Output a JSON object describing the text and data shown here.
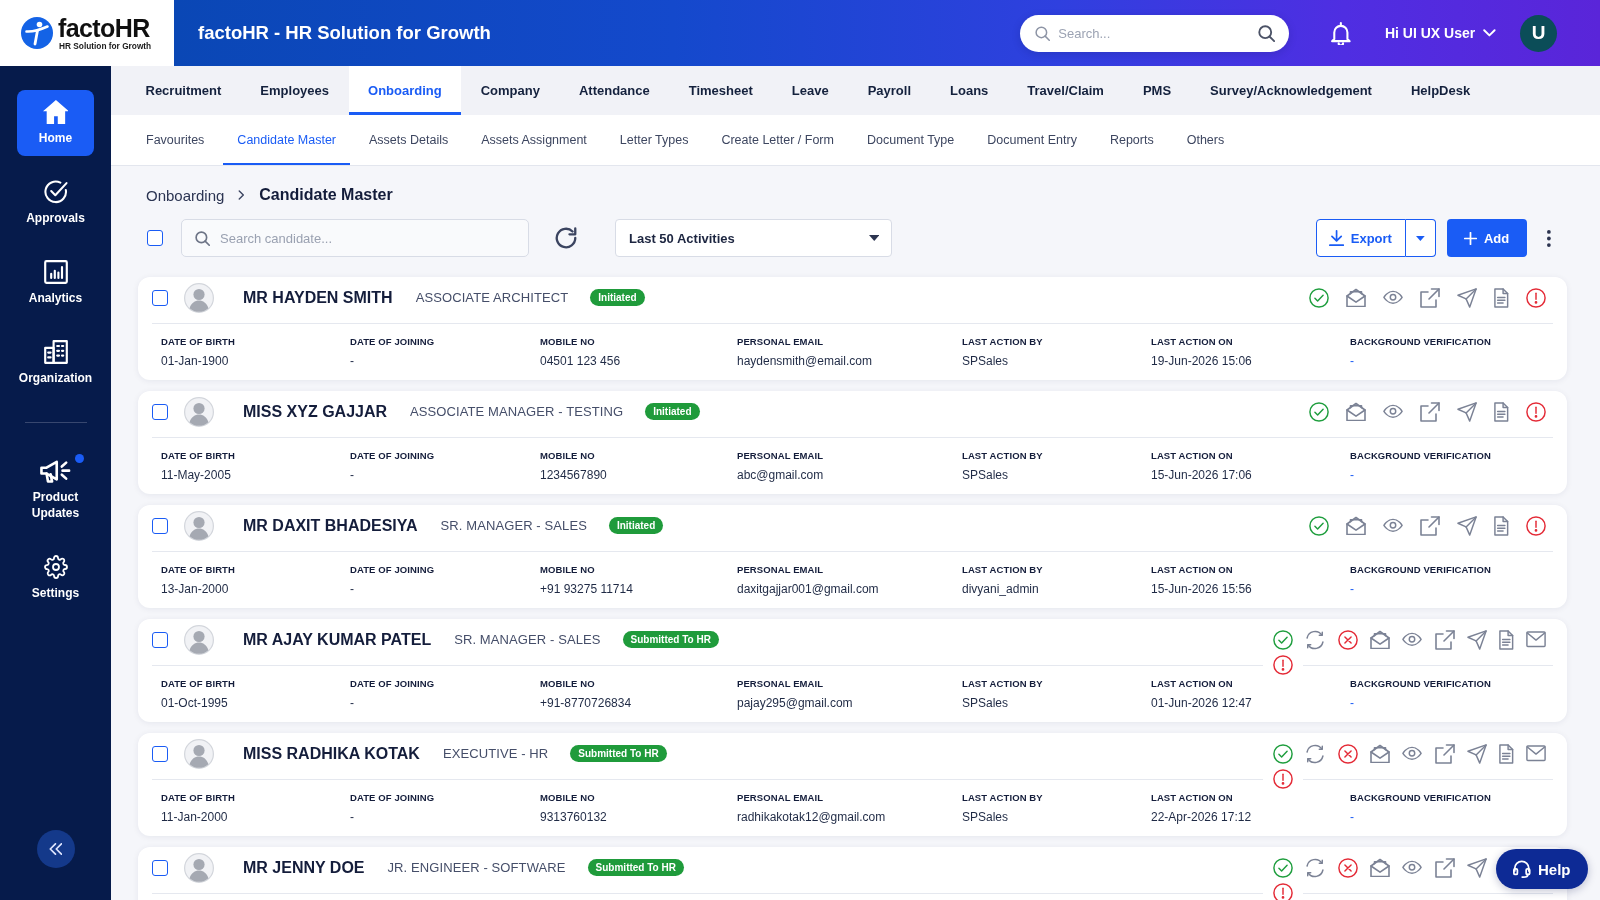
{
  "header": {
    "logo": {
      "name": "factoHR",
      "tagline": "HR Solution for Growth"
    },
    "title": "factoHR - HR Solution for Growth",
    "search": {
      "placeholder": "Search..."
    },
    "user": {
      "greeting": "Hi UI UX User",
      "initial": "U"
    }
  },
  "sidebar": {
    "sections": [
      {
        "items": [
          {
            "label": "Home",
            "selected": true,
            "unread": false
          },
          {
            "label": "Approvals",
            "selected": false,
            "unread": false
          },
          {
            "label": "Analytics",
            "selected": false,
            "unread": false
          },
          {
            "label": "Organization",
            "selected": false,
            "unread": false
          }
        ]
      },
      {
        "items": [
          {
            "label": "Product Updates",
            "selected": false,
            "unread": true
          },
          {
            "label": "Settings",
            "selected": false,
            "unread": false
          }
        ]
      }
    ]
  },
  "nav_tabs": [
    {
      "label": "Recruitment",
      "selected": false
    },
    {
      "label": "Employees",
      "selected": false
    },
    {
      "label": "Onboarding",
      "selected": true
    },
    {
      "label": "Company",
      "selected": false
    },
    {
      "label": "Attendance",
      "selected": false
    },
    {
      "label": "Timesheet",
      "selected": false
    },
    {
      "label": "Leave",
      "selected": false
    },
    {
      "label": "Payroll",
      "selected": false
    },
    {
      "label": "Loans",
      "selected": false
    },
    {
      "label": "Travel/Claim",
      "selected": false
    },
    {
      "label": "PMS",
      "selected": false
    },
    {
      "label": "Survey/Acknowledgement",
      "selected": false
    },
    {
      "label": "HelpDesk",
      "selected": false
    }
  ],
  "sub_tabs": [
    {
      "label": "Favourites",
      "selected": false
    },
    {
      "label": "Candidate Master",
      "selected": true
    },
    {
      "label": "Assets Details",
      "selected": false
    },
    {
      "label": "Assets Assignment",
      "selected": false
    },
    {
      "label": "Letter Types",
      "selected": false
    },
    {
      "label": "Create Letter / Form",
      "selected": false
    },
    {
      "label": "Document Type",
      "selected": false
    },
    {
      "label": "Document Entry",
      "selected": false
    },
    {
      "label": "Reports",
      "selected": false
    },
    {
      "label": "Others",
      "selected": false
    }
  ],
  "breadcrumb": [
    "Onboarding",
    "Candidate Master"
  ],
  "toolbar": {
    "select_all": {
      "checked": false
    },
    "search": {
      "placeholder": "Search candidate..."
    },
    "filter": {
      "value": "Last 50 Activities"
    },
    "export": {
      "label": "Export"
    },
    "add": {
      "label": "Add"
    }
  },
  "candidates": [
    {
      "checked": false,
      "kind": "initiated",
      "name": "MR HAYDEN SMITH",
      "designation": "ASSOCIATE ARCHITECT",
      "status": {
        "label": "Initiated"
      },
      "details": [
        {
          "kind": "text",
          "label": "DATE OF BIRTH",
          "value": "01-Jan-1900"
        },
        {
          "kind": "text",
          "label": "DATE OF JOINING",
          "value": "-"
        },
        {
          "kind": "text",
          "label": "MOBILE NO",
          "value": "04501 123 456"
        },
        {
          "kind": "text",
          "label": "PERSONAL EMAIL",
          "value": "haydensmith@email.com"
        },
        {
          "kind": "text",
          "label": "LAST ACTION BY",
          "value": "SPSales"
        },
        {
          "kind": "text",
          "label": "LAST ACTION ON",
          "value": "19-Jun-2026 15:06"
        },
        {
          "kind": "link",
          "label": "BACKGROUND VERIFICATION",
          "value": "-"
        }
      ]
    },
    {
      "checked": false,
      "kind": "initiated",
      "name": "MISS XYZ GAJJAR",
      "designation": "ASSOCIATE MANAGER - TESTING",
      "status": {
        "label": "Initiated"
      },
      "details": [
        {
          "kind": "text",
          "label": "DATE OF BIRTH",
          "value": "11-May-2005"
        },
        {
          "kind": "text",
          "label": "DATE OF JOINING",
          "value": "-"
        },
        {
          "kind": "text",
          "label": "MOBILE NO",
          "value": "1234567890"
        },
        {
          "kind": "text",
          "label": "PERSONAL EMAIL",
          "value": "abc@gmail.com"
        },
        {
          "kind": "text",
          "label": "LAST ACTION BY",
          "value": "SPSales"
        },
        {
          "kind": "text",
          "label": "LAST ACTION ON",
          "value": "15-Jun-2026 17:06"
        },
        {
          "kind": "link",
          "label": "BACKGROUND VERIFICATION",
          "value": "-"
        }
      ]
    },
    {
      "checked": false,
      "kind": "initiated",
      "name": "MR DAXIT BHADESIYA",
      "designation": "SR. MANAGER - SALES",
      "status": {
        "label": "Initiated"
      },
      "details": [
        {
          "kind": "text",
          "label": "DATE OF BIRTH",
          "value": "13-Jan-2000"
        },
        {
          "kind": "text",
          "label": "DATE OF JOINING",
          "value": "-"
        },
        {
          "kind": "text",
          "label": "MOBILE NO",
          "value": "+91 93275 11714"
        },
        {
          "kind": "text",
          "label": "PERSONAL EMAIL",
          "value": "daxitgajjar001@gmail.com"
        },
        {
          "kind": "text",
          "label": "LAST ACTION BY",
          "value": "divyani_admin"
        },
        {
          "kind": "text",
          "label": "LAST ACTION ON",
          "value": "15-Jun-2026 15:56"
        },
        {
          "kind": "link",
          "label": "BACKGROUND VERIFICATION",
          "value": "-"
        }
      ]
    },
    {
      "checked": false,
      "kind": "submitted",
      "name": "MR AJAY KUMAR PATEL",
      "designation": "SR. MANAGER - SALES",
      "status": {
        "label": "Submitted To HR"
      },
      "details": [
        {
          "kind": "text",
          "label": "DATE OF BIRTH",
          "value": "01-Oct-1995"
        },
        {
          "kind": "text",
          "label": "DATE OF JOINING",
          "value": "-"
        },
        {
          "kind": "text",
          "label": "MOBILE NO",
          "value": "+91-8770726834"
        },
        {
          "kind": "text",
          "label": "PERSONAL EMAIL",
          "value": "pajay295@gmail.com"
        },
        {
          "kind": "text",
          "label": "LAST ACTION BY",
          "value": "SPSales"
        },
        {
          "kind": "text",
          "label": "LAST ACTION ON",
          "value": "01-Jun-2026 12:47"
        },
        {
          "kind": "link",
          "label": "BACKGROUND VERIFICATION",
          "value": "-"
        }
      ]
    },
    {
      "checked": false,
      "kind": "submitted",
      "name": "MISS RADHIKA KOTAK",
      "designation": "EXECUTIVE - HR",
      "status": {
        "label": "Submitted To HR"
      },
      "details": [
        {
          "kind": "text",
          "label": "DATE OF BIRTH",
          "value": "11-Jan-2000"
        },
        {
          "kind": "text",
          "label": "DATE OF JOINING",
          "value": "-"
        },
        {
          "kind": "text",
          "label": "MOBILE NO",
          "value": "9313760132"
        },
        {
          "kind": "text",
          "label": "PERSONAL EMAIL",
          "value": "radhikakotak12@gmail.com"
        },
        {
          "kind": "text",
          "label": "LAST ACTION BY",
          "value": "SPSales"
        },
        {
          "kind": "text",
          "label": "LAST ACTION ON",
          "value": "22-Apr-2026 17:12"
        },
        {
          "kind": "link",
          "label": "BACKGROUND VERIFICATION",
          "value": "-"
        }
      ]
    },
    {
      "checked": false,
      "kind": "submitted",
      "name": "MR JENNY DOE",
      "designation": "JR. ENGINEER - SOFTWARE",
      "status": {
        "label": "Submitted To HR"
      }
    }
  ],
  "help": {
    "label": "Help"
  }
}
